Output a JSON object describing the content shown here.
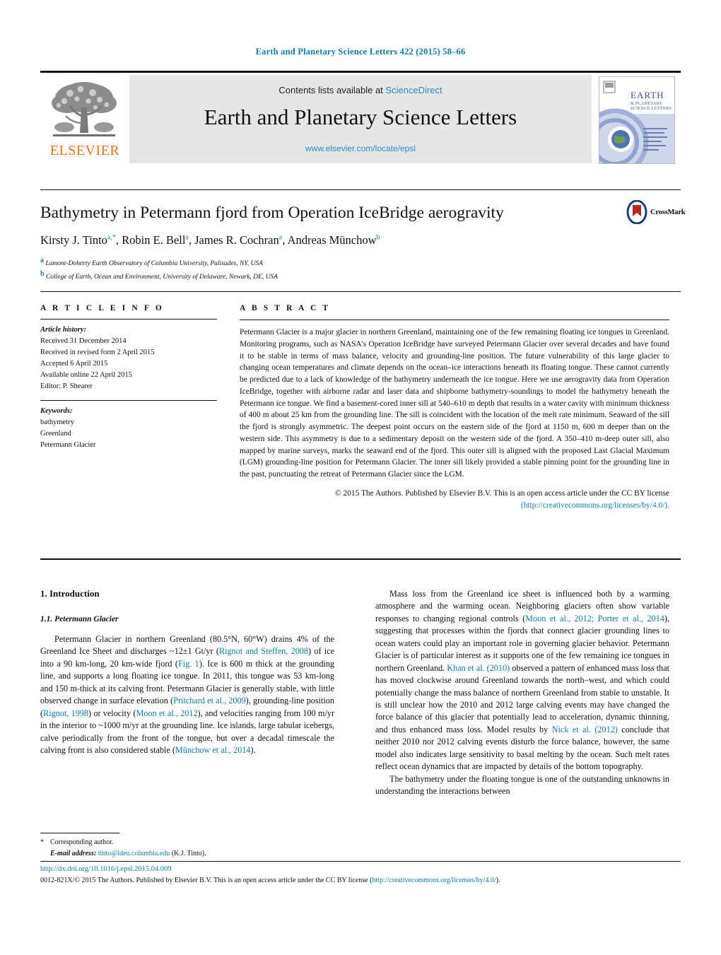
{
  "running_head": "Earth and Planetary Science Letters 422 (2015) 58–66",
  "masthead": {
    "contents_prefix": "Contents lists available at ",
    "sciencedirect": "ScienceDirect",
    "journal_title": "Earth and Planetary Science Letters",
    "journal_url": "www.elsevier.com/locate/epsl",
    "publisher_wordmark": "ELSEVIER",
    "cover": {
      "title_line1": "EARTH",
      "title_line2": "& PLANETARY",
      "title_line3": "SCIENCE LETTERS"
    }
  },
  "article": {
    "title": "Bathymetry in Petermann fjord from Operation IceBridge aerogravity",
    "crossmark_label": "CrossMark",
    "authors": [
      {
        "name": "Kirsty J. Tinto",
        "marks": "a,*"
      },
      {
        "name": "Robin E. Bell",
        "marks": "a"
      },
      {
        "name": "James R. Cochran",
        "marks": "a"
      },
      {
        "name": "Andreas Münchow",
        "marks": "b"
      }
    ],
    "affiliations": [
      {
        "mark": "a",
        "text": "Lamont-Doherty Earth Observatory of Columbia University, Palisades, NY, USA"
      },
      {
        "mark": "b",
        "text": "College of Earth, Ocean and Environment, University of Delaware, Newark, DE, USA"
      }
    ]
  },
  "article_info": {
    "heading": "A R T I C L E   I N F O",
    "history_label": "Article history:",
    "history": [
      "Received 31 December 2014",
      "Received in revised form 2 April 2015",
      "Accepted 6 April 2015",
      "Available online 22 April 2015",
      "Editor: P. Shearer"
    ],
    "keywords_label": "Keywords:",
    "keywords": [
      "bathymetry",
      "Greenland",
      "Petermann Glacier"
    ]
  },
  "abstract": {
    "heading": "A B S T R A C T",
    "text": "Petermann Glacier is a major glacier in northern Greenland, maintaining one of the few remaining floating ice tongues in Greenland. Monitoring programs, such as NASA's Operation IceBridge have surveyed Petermann Glacier over several decades and have found it to be stable in terms of mass balance, velocity and grounding-line position. The future vulnerability of this large glacier to changing ocean temperatures and climate depends on the ocean–ice interactions beneath its floating tongue. These cannot currently be predicted due to a lack of knowledge of the bathymetry underneath the ice tongue. Here we use aerogravity data from Operation IceBridge, together with airborne radar and laser data and shipborne bathymetry-soundings to model the bathymetry beneath the Petermann ice tongue. We find a basement-cored inner sill at 540–610 m depth that results in a water cavity with minimum thickness of 400 m about 25 km from the grounding line. The sill is coincident with the location of the melt rate minimum. Seaward of the sill the fjord is strongly asymmetric. The deepest point occurs on the eastern side of the fjord at 1150 m, 600 m deeper than on the western side. This asymmetry is due to a sedimentary deposit on the western side of the fjord. A 350–410 m-deep outer sill, also mapped by marine surveys, marks the seaward end of the fjord. This outer sill is aligned with the proposed Last Glacial Maximum (LGM) grounding-line position for Petermann Glacier. The inner sill likely provided a stable pinning point for the grounding line in the past, punctuating the retreat of Petermann Glacier since the LGM.",
    "copyright": "© 2015 The Authors. Published by Elsevier B.V. This is an open access article under the CC BY license",
    "license_url": "(http://creativecommons.org/licenses/by/4.0/)."
  },
  "body": {
    "section_number_title": "1. Introduction",
    "subsection_title": "1.1. Petermann Glacier",
    "left_paragraph_1": {
      "part1": "Petermann Glacier in northern Greenland (80.5°N, 60°W) drains 4% of the Greenland Ice Sheet and discharges ~12±1 Gt/yr (",
      "cit1": "Rignot and Steffen, 2008",
      "part2": ") of ice into a 90 km-long, 20 km-wide fjord (",
      "cit2": "Fig. 1",
      "part3": "). Ice is 600 m thick at the grounding line, and supports a long floating ice tongue. In 2011, this tongue was 53 km-long and 150 m-thick at its calving front. Petermann Glacier is generally stable, with little observed change in surface elevation (",
      "cit3": "Pritchard et al., 2009",
      "part4": "), grounding-line position (",
      "cit4": "Rignot, 1998",
      "part5": ") or velocity (",
      "cit5": "Moon et al., 2012",
      "part6": "), and velocities ranging from 100 m/yr in the interior to ~1000 m/yr at the grounding line. Ice islands, large tabular icebergs, calve periodically from the front of the tongue, but over a decadal timescale the calving front is also considered stable (",
      "cit6": "Münchow et al., 2014",
      "part7": ")."
    },
    "right_paragraph_1": {
      "part1": "Mass loss from the Greenland ice sheet is influenced both by a warming atmosphere and the warming ocean. Neighboring glaciers often show variable responses to changing regional controls (",
      "cit1": "Moon et al., 2012; Porter et al., 2014",
      "part2": "), suggesting that processes within the fjords that connect glacier grounding lines to ocean waters could play an important role in governing glacier behavior. Petermann Glacier is of particular interest as it supports one of the few remaining ice tongues in northern Greenland. ",
      "cit2": "Khan et al. (2010)",
      "part3": " observed a pattern of enhanced mass loss that has moved clockwise around Greenland towards the north–west, and which could potentially change the mass balance of northern Greenland from stable to unstable. It is still unclear how the 2010 and 2012 large calving events may have changed the force balance of this glacier that potentially lead to acceleration, dynamic thinning, and thus enhanced mass loss. Model results by ",
      "cit3": "Nick et al. (2012)",
      "part4": " conclude that neither 2010 nor 2012 calving events disturb the force balance, however, the same model also indicates large sensitivity to basal melting by the ocean. Such melt rates reflect ocean dynamics that are impacted by details of the bottom topography."
    },
    "right_paragraph_2": "The bathymetry under the floating tongue is one of the outstanding unknowns in understanding the interactions between"
  },
  "footnote": {
    "corresponding_author": "Corresponding author.",
    "email_label": "E-mail address:",
    "email": "tinto@ldeo.columbia.edu",
    "email_owner": "(K.J. Tinto)."
  },
  "footer": {
    "doi": "http://dx.doi.org/10.1016/j.epsl.2015.04.009",
    "issn_copyright": "0012-821X/© 2015 The Authors. Published by Elsevier B.V. This is an open access article under the CC BY license (",
    "license_url": "http://creativecommons.org/licenses/by/4.0/",
    "issn_tail": ")."
  },
  "colors": {
    "link": "#0c7cb0",
    "elsevier_orange": "#F36F21",
    "masthead_grey": "#e6e6e6"
  }
}
